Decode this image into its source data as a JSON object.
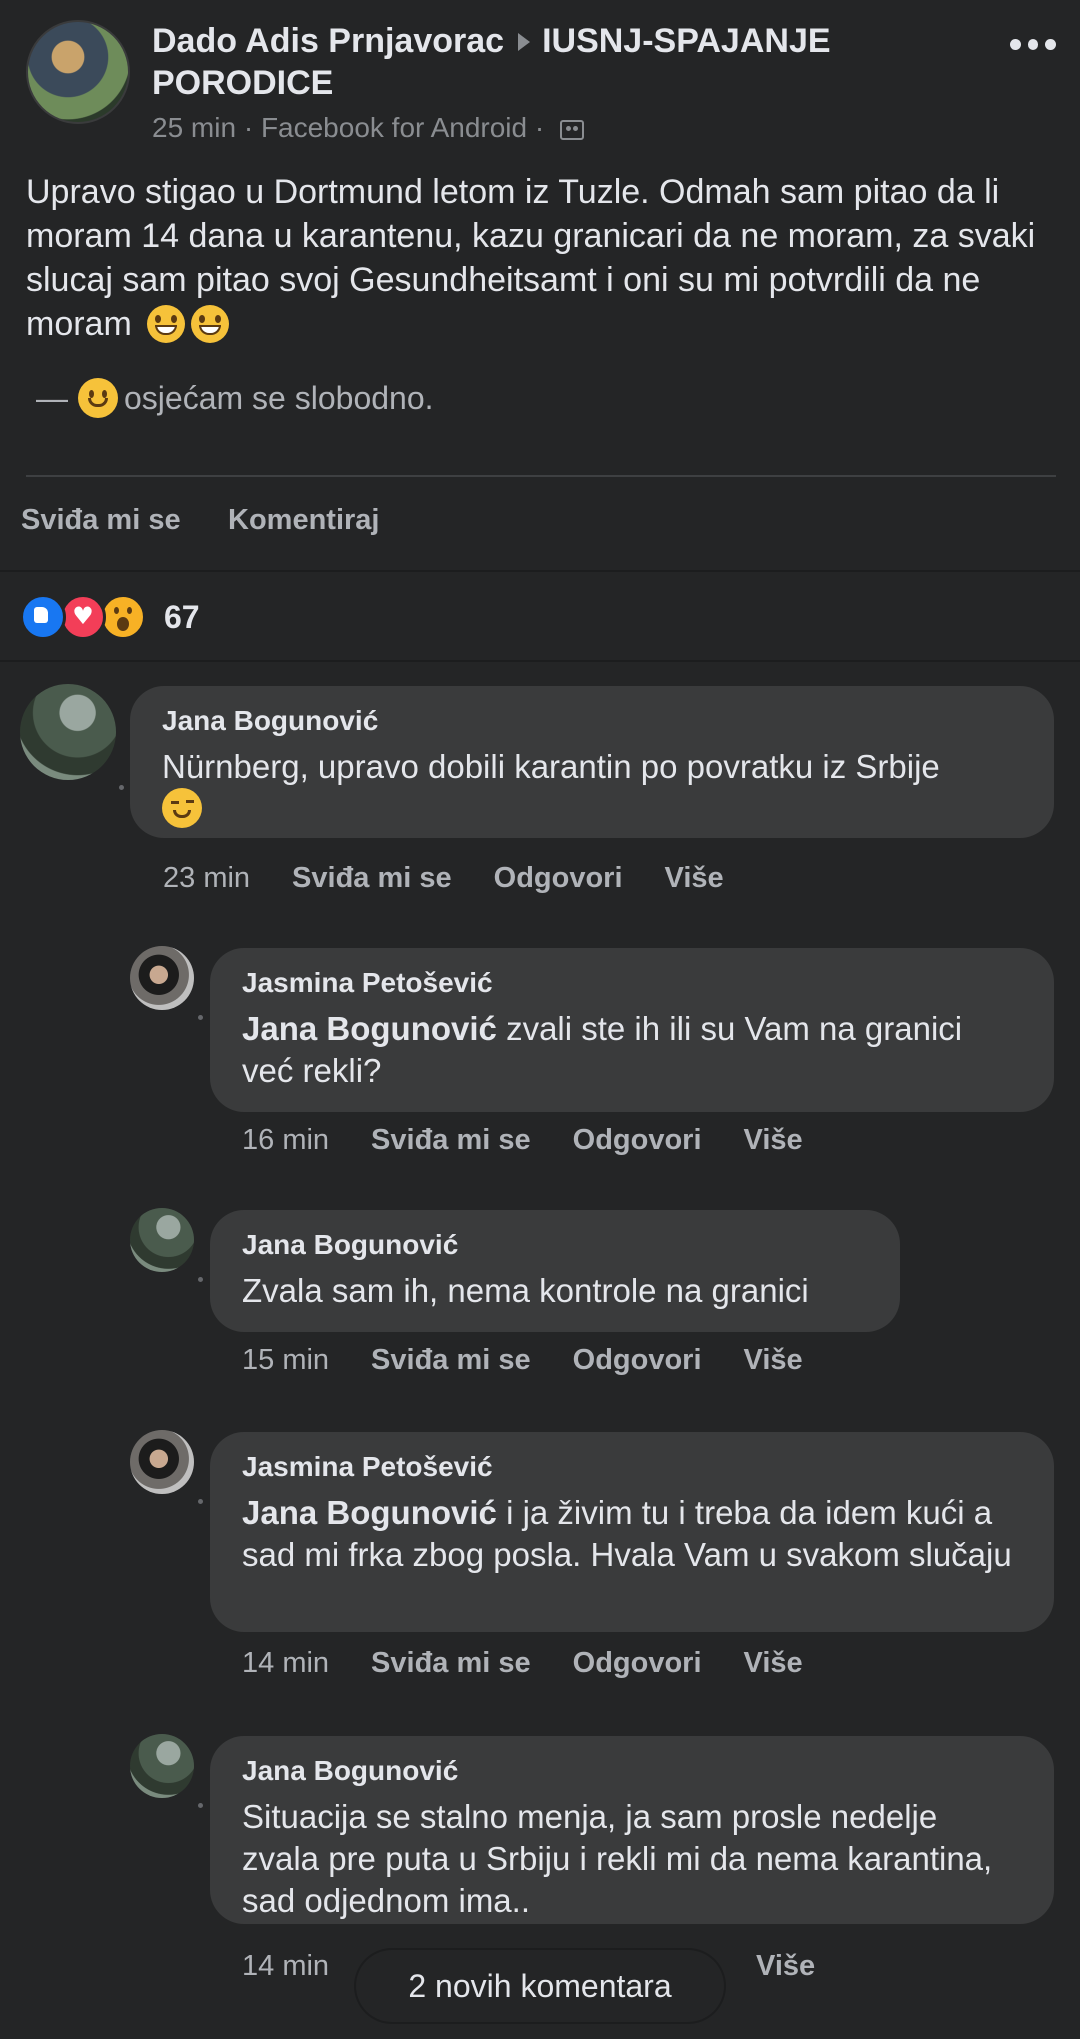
{
  "post": {
    "author": "Dado Adis Prnjavorac",
    "group": "IUSNJ-SPAJANJE PORODICE",
    "time": "25 min",
    "source": "Facebook for Android",
    "separator": "·",
    "more_icon": "more-dots-icon",
    "privacy_icon": "group-members-icon",
    "text": "Upravo stigao u Dortmund letom iz Tuzle. Odmah sam pitao da li moram 14 dana u karantenu, kazu granicari da ne moram, za svaki slucaj sam pitao svoj Gesundheitsamt i oni su mi potvrdili da ne moram",
    "feeling_prefix": "—",
    "feeling": "osjećam se slobodno."
  },
  "actions": {
    "like": "Sviđa mi se",
    "comment": "Komentiraj"
  },
  "reactions": {
    "count": "67",
    "types": [
      "like",
      "love",
      "wow"
    ]
  },
  "comments": [
    {
      "name": "Jana Bogunović",
      "text": "Nürnberg, upravo dobili karantin po povratku iz Srbije",
      "time": "23 min",
      "like": "Sviđa mi se",
      "reply": "Odgovori",
      "more": "Više"
    },
    {
      "name": "Jasmina Petošević",
      "mention": "Jana Bogunović",
      "text": "zvali ste ih ili su Vam na granici već rekli?",
      "time": "16 min",
      "like": "Sviđa mi se",
      "reply": "Odgovori",
      "more": "Više"
    },
    {
      "name": "Jana Bogunović",
      "text": "Zvala sam ih, nema kontrole na granici",
      "time": "15 min",
      "like": "Sviđa mi se",
      "reply": "Odgovori",
      "more": "Više"
    },
    {
      "name": "Jasmina Petošević",
      "mention": "Jana Bogunović",
      "text": "i ja živim tu i treba da idem kući a sad mi frka zbog posla. Hvala Vam u svakom slučaju",
      "time": "14 min",
      "like": "Sviđa mi se",
      "reply": "Odgovori",
      "more": "Više"
    },
    {
      "name": "Jana Bogunović",
      "text": "Situacija se stalno menja, ja sam prosle nedelje zvala pre puta u Srbiju i rekli mi da nema karantina, sad odjednom ima..",
      "time": "14 min",
      "more": "Više"
    }
  ],
  "new_comments": "2 novih komentara"
}
